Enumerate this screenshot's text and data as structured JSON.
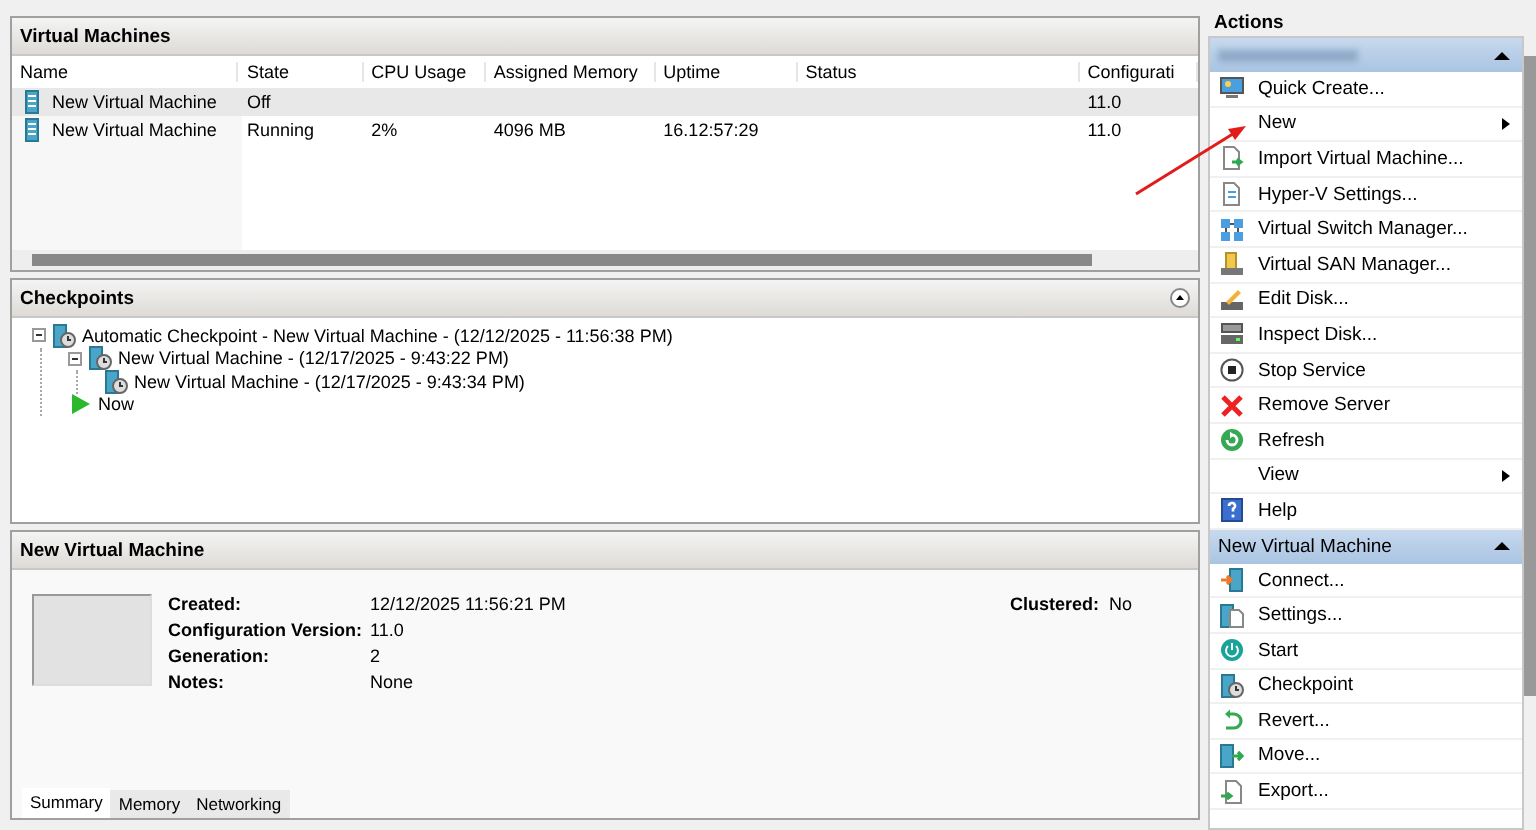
{
  "vm_panel": {
    "title": "Virtual Machines",
    "columns": [
      "Name",
      "State",
      "CPU Usage",
      "Assigned Memory",
      "Uptime",
      "Status",
      "Configurati"
    ],
    "rows": [
      {
        "selected": true,
        "cells": [
          "New Virtual Machine",
          "Off",
          "",
          "",
          "",
          "",
          "11.0"
        ]
      },
      {
        "selected": false,
        "cells": [
          "New Virtual Machine",
          "Running",
          "2%",
          "4096 MB",
          "16.12:57:29",
          "",
          "11.0"
        ]
      }
    ]
  },
  "checkpoints_panel": {
    "title": "Checkpoints",
    "tree": [
      {
        "label": "Automatic Checkpoint - New Virtual Machine - (12/12/2025 - 11:56:38 PM)",
        "kind": "checkpoint",
        "expanded": true,
        "children": [
          {
            "label": "New Virtual Machine - (12/17/2025 - 9:43:22 PM)",
            "kind": "checkpoint",
            "expanded": true,
            "children": [
              {
                "label": "New Virtual Machine - (12/17/2025 - 9:43:34 PM)",
                "kind": "checkpoint"
              }
            ]
          },
          {
            "label": "Now",
            "kind": "now"
          }
        ]
      }
    ]
  },
  "details_panel": {
    "title": "New Virtual Machine",
    "fields": [
      {
        "label": "Created:",
        "value": "12/12/2025 11:56:21 PM"
      },
      {
        "label": "Configuration Version:",
        "value": "11.0"
      },
      {
        "label": "Generation:",
        "value": "2"
      },
      {
        "label": "Notes:",
        "value": "None"
      }
    ],
    "clustered": {
      "label": "Clustered:",
      "value": "No"
    },
    "tabs": [
      {
        "label": "Summary",
        "selected": true
      },
      {
        "label": "Memory",
        "selected": false
      },
      {
        "label": "Networking",
        "selected": false
      }
    ]
  },
  "actions": {
    "title": "Actions",
    "groups": [
      {
        "items": [
          {
            "label": "Quick Create...",
            "submenu": false
          },
          {
            "label": "New",
            "submenu": true
          },
          {
            "label": "Import Virtual Machine...",
            "submenu": false
          },
          {
            "label": "Hyper-V Settings...",
            "submenu": false
          },
          {
            "label": "Virtual Switch Manager...",
            "submenu": false
          },
          {
            "label": "Virtual SAN Manager...",
            "submenu": false
          },
          {
            "label": "Edit Disk...",
            "submenu": false
          },
          {
            "label": "Inspect Disk...",
            "submenu": false
          },
          {
            "label": "Stop Service",
            "submenu": false
          },
          {
            "label": "Remove Server",
            "submenu": false
          },
          {
            "label": "Refresh",
            "submenu": false
          },
          {
            "label": "View",
            "submenu": true
          },
          {
            "label": "Help",
            "submenu": false
          }
        ]
      },
      {
        "title": "New Virtual Machine",
        "items": [
          {
            "label": "Connect...",
            "submenu": false
          },
          {
            "label": "Settings...",
            "submenu": false
          },
          {
            "label": "Start",
            "submenu": false
          },
          {
            "label": "Checkpoint",
            "submenu": false
          },
          {
            "label": "Revert...",
            "submenu": false
          },
          {
            "label": "Move...",
            "submenu": false
          },
          {
            "label": "Export...",
            "submenu": false
          }
        ]
      }
    ]
  }
}
